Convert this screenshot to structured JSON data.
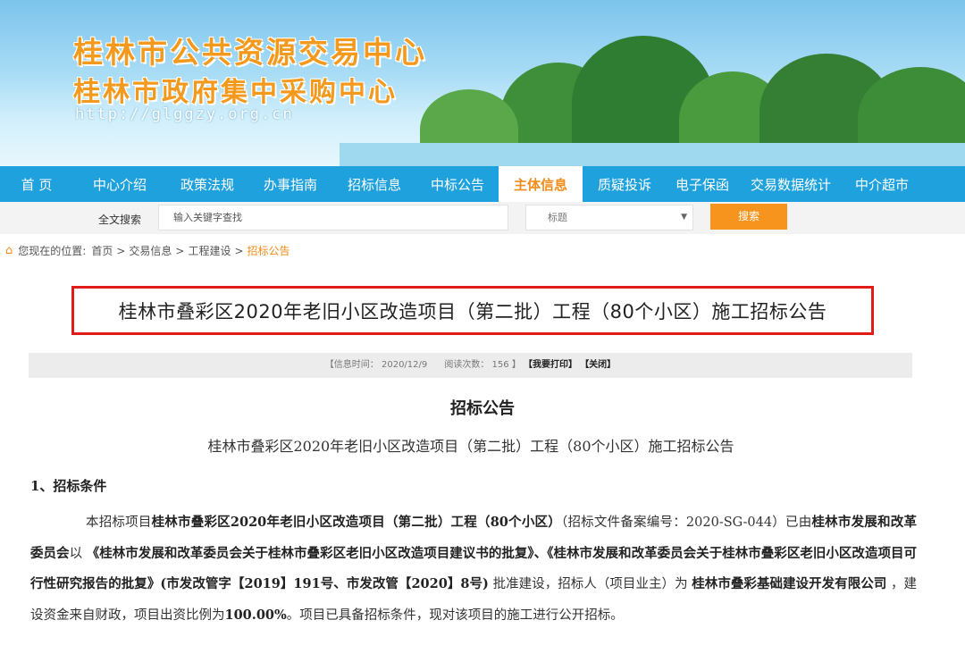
{
  "banner": {
    "title_line1": "桂林市公共资源交易中心",
    "title_line2": "桂林市政府集中采购中心",
    "url": "http://glggzy.org.cn"
  },
  "nav": {
    "items": [
      {
        "label": "首 页"
      },
      {
        "label": "中心介绍"
      },
      {
        "label": "政策法规"
      },
      {
        "label": "办事指南"
      },
      {
        "label": "招标信息"
      },
      {
        "label": "中标公告"
      },
      {
        "label": "主体信息"
      },
      {
        "label": "质疑投诉"
      },
      {
        "label": "电子保函"
      },
      {
        "label": "交易数据统计"
      },
      {
        "label": "中介超市"
      }
    ],
    "active_index": 6
  },
  "search": {
    "label": "全文搜索",
    "placeholder": "输入关键字查找",
    "select_value": "标题",
    "button_label": "搜索"
  },
  "breadcrumb": {
    "prefix": "您现在的位置:",
    "items": [
      "首页",
      "交易信息",
      "工程建设"
    ],
    "current": "招标公告"
  },
  "notice": {
    "title": "桂林市叠彩区2020年老旧小区改造项目（第二批）工程（80个小区）施工招标公告",
    "info_time_label": "【信息时间：",
    "info_time": "2020/12/9",
    "read_label": "阅读次数：",
    "read_count": "156",
    "info_close": "】",
    "print_label": "【我要打印】",
    "close_label": "【关闭】",
    "heading": "招标公告",
    "subheading": "桂林市叠彩区2020年老旧小区改造项目（第二批）工程（80个小区）施工招标公告",
    "section1": "1、招标条件",
    "para": {
      "t1": "本招标项目",
      "b1": "桂林市叠彩区2020年老旧小区改造项目（第二批）工程（80个小区）",
      "t2": "（招标文件备案编号：2020-SG-044）已由",
      "b2": "桂林市发展和改革委员会",
      "t3": "以 ",
      "b3": "《桂林市发展和改革委员会关于桂林市叠彩区老旧小区改造项目建议书的批复》、《桂林市发展和改革委员会关于桂林市叠彩区老旧小区改造项目可行性研究报告的批复》(市发改管字【2019】191号、市发改管【2020】8号)",
      "t4": " 批准建设，招标人（项目业主）为 ",
      "b4": "桂林市叠彩基础建设开发有限公司",
      "t5": " ，建设资金来自财政，项目出资比例为",
      "b5": "100.00%",
      "t6": "。项目已具备招标条件，现对该项目的施工进行公开招标。"
    }
  }
}
